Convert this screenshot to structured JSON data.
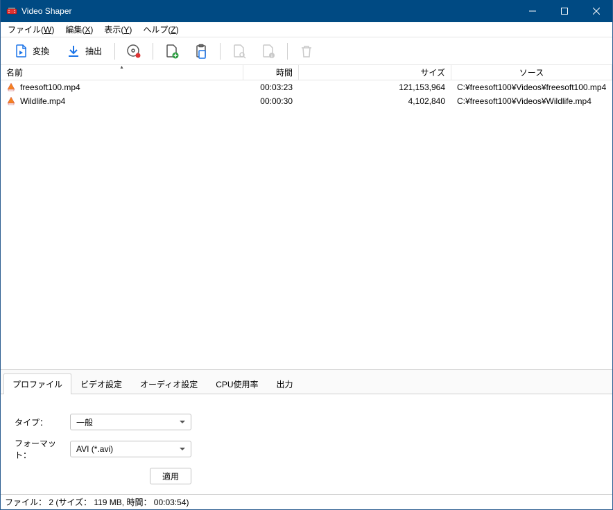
{
  "window": {
    "title": "Video Shaper"
  },
  "menu": {
    "file": "ファイル(W)",
    "edit": "編集(X)",
    "view": "表示(Y)",
    "help": "ヘルプ(Z)"
  },
  "toolbar": {
    "convert": "変換",
    "extract": "抽出"
  },
  "columns": {
    "name": "名前",
    "time": "時間",
    "size": "サイズ",
    "source": "ソース"
  },
  "rows": [
    {
      "name": "freesoft100.mp4",
      "time": "00:03:23",
      "size": "121,153,964",
      "source": "C:¥freesoft100¥Videos¥freesoft100.mp4"
    },
    {
      "name": "Wildlife.mp4",
      "time": "00:00:30",
      "size": "4,102,840",
      "source": "C:¥freesoft100¥Videos¥Wildlife.mp4"
    }
  ],
  "tabs": {
    "profile": "プロファイル",
    "video": "ビデオ設定",
    "audio": "オーディオ設定",
    "cpu": "CPU使用率",
    "output": "出力"
  },
  "form": {
    "type_label": "タイプ：",
    "type_value": "一般",
    "format_label": "フォーマット：",
    "format_value": "AVI (*.avi)",
    "apply": "適用"
  },
  "status": "ファイル： 2 (サイズ： 119 MB, 時間： 00:03:54)"
}
